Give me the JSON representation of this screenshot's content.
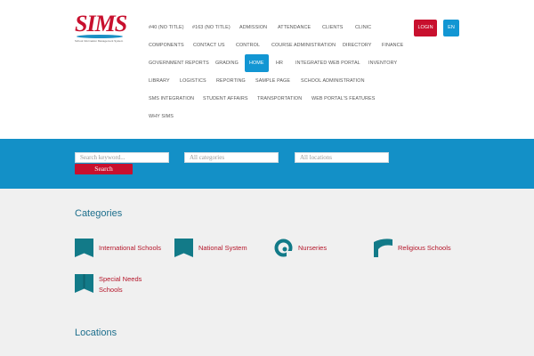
{
  "logo": {
    "name": "SIMS",
    "tagline": "School Information Management System"
  },
  "nav": {
    "rows": [
      [
        "#40 (NO TITLE)",
        "#163 (NO TITLE)",
        "ADMISSION",
        "ATTENDANCE",
        "CLIENTS",
        "CLINIC"
      ],
      [
        "COMPONENTS",
        "CONTACT US",
        "CONTROL",
        "COURSE ADMINISTRATION",
        "DIRECTORY",
        "FINANCE"
      ],
      [
        "GOVERNMENT REPORTS",
        "GRADING",
        "HOME",
        "HR",
        "INTEGRATED WEB PORTAL",
        "INVENTORY"
      ],
      [
        "LIBRARY",
        "LOGISTICS",
        "REPORTING",
        "SAMPLE PAGE",
        "SCHOOL ADMINISTRATION"
      ],
      [
        "SMS INTEGRATION",
        "STUDENT AFFAIRS",
        "TRANSPORTATION",
        "WEB PORTAL'S FEATURES"
      ],
      [
        "WHY SIMS"
      ]
    ],
    "active": "HOME"
  },
  "header_buttons": {
    "login": "LOGIN",
    "language": "EN"
  },
  "search": {
    "keyword_placeholder": "Search keyword...",
    "category_placeholder": "All categories",
    "location_placeholder": "All locations",
    "button_label": "Search"
  },
  "categories": {
    "title": "Categories",
    "items": [
      {
        "label": "International Schools",
        "icon": "book-icon"
      },
      {
        "label": "National System",
        "icon": "book-icon"
      },
      {
        "label": "Nurseries",
        "icon": "swirl-icon"
      },
      {
        "label": "Religious Schools",
        "icon": "flag-icon"
      },
      {
        "label": "Special Needs Schools",
        "icon": "book-icon"
      }
    ]
  },
  "locations": {
    "title": "Locations"
  },
  "colors": {
    "brand_red": "#c8102e",
    "brand_blue": "#1296d3",
    "icon_teal": "#127a88"
  }
}
